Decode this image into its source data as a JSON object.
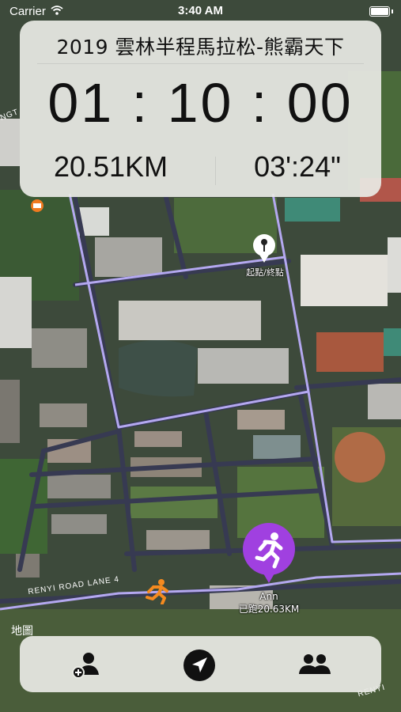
{
  "status_bar": {
    "carrier": "Carrier",
    "time": "3:40 AM"
  },
  "race": {
    "title": "2019 雲林半程馬拉松-熊霸天下",
    "elapsed": "01 : 10 : 00",
    "distance": "20.51KM",
    "pace": "03':24\""
  },
  "map": {
    "start_pin_label": "起點/終點",
    "runner_name": "Ann",
    "runner_progress": "已跑20.63KM",
    "road_label": "RENYI ROAD LANE 4",
    "road_label_top_left": "NGT",
    "road_label_bottom_right": "RENYI",
    "legal_label": "地圖",
    "route_color": "#b4a8f0",
    "runner_pin_color": "#a040e0",
    "other_runner_color": "#f58a1f"
  },
  "toolbar": {
    "add_user_icon": "add-person-icon",
    "locate_icon": "location-arrow-icon",
    "group_icon": "people-icon"
  }
}
